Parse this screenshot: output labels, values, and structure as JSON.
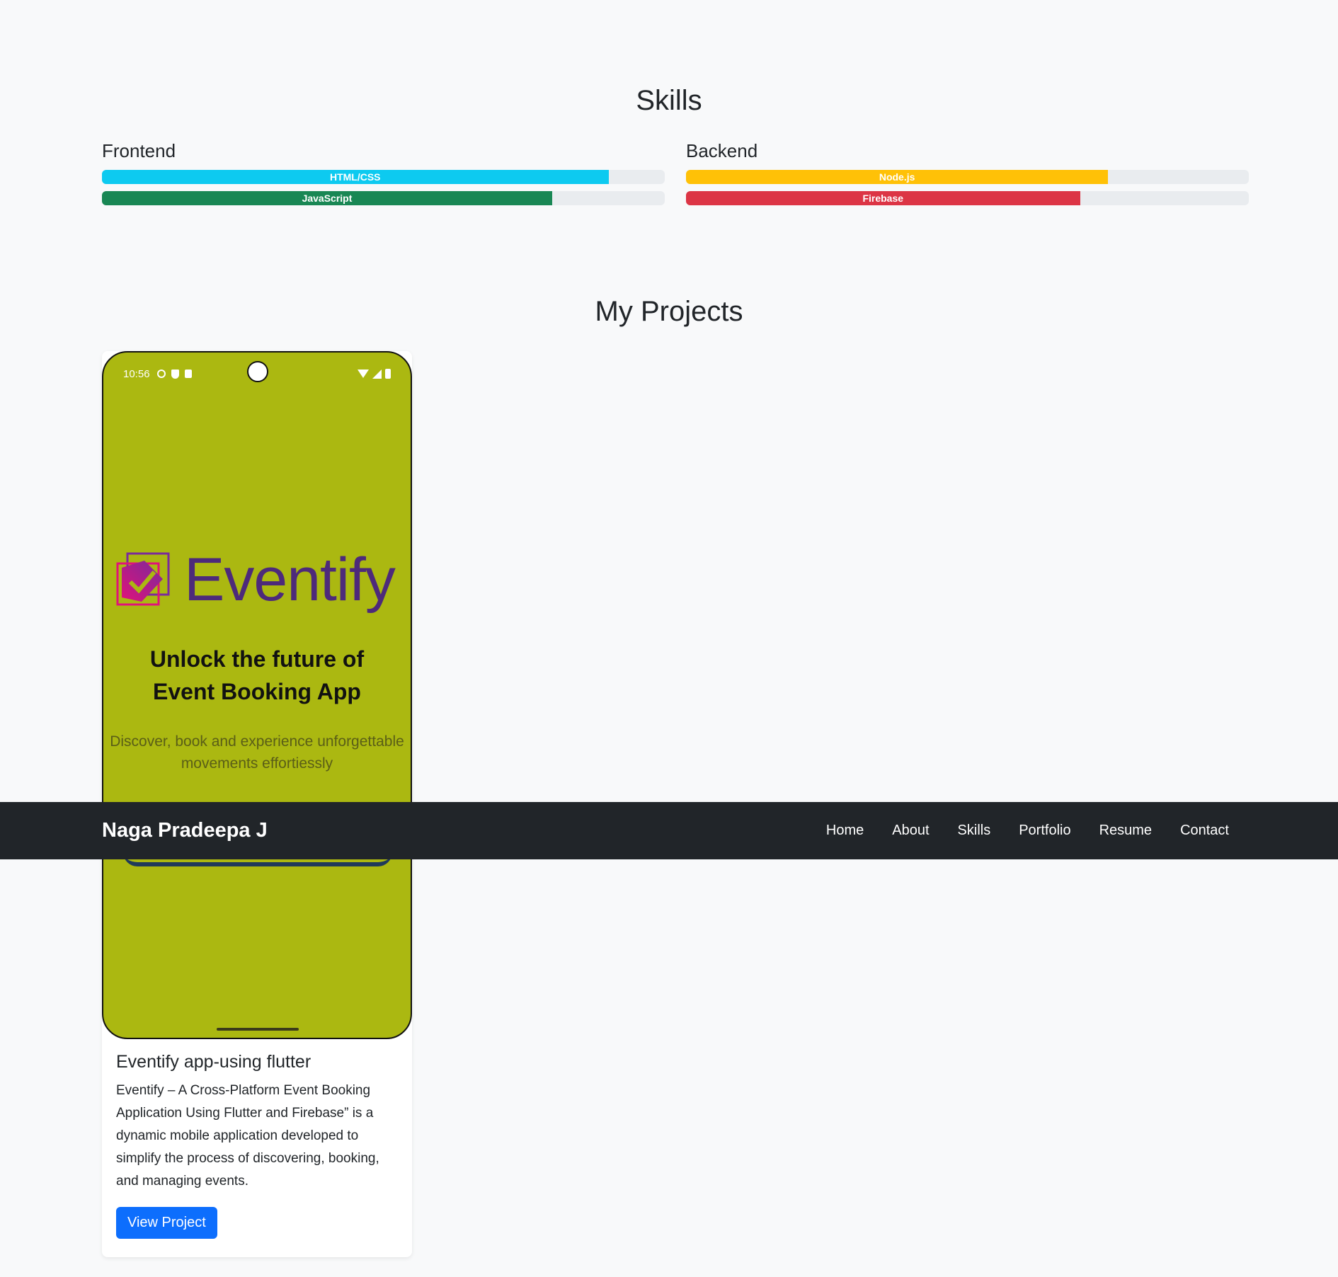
{
  "skills": {
    "title": "Skills",
    "frontend": {
      "heading": "Frontend",
      "items": [
        {
          "label": "HTML/CSS",
          "percent": 90,
          "color": "#0dcaf0"
        },
        {
          "label": "JavaScript",
          "percent": 80,
          "color": "#198754"
        }
      ]
    },
    "backend": {
      "heading": "Backend",
      "items": [
        {
          "label": "Node.js",
          "percent": 75,
          "color": "#ffc107"
        },
        {
          "label": "Firebase",
          "percent": 70,
          "color": "#dc3545"
        }
      ]
    }
  },
  "projects": {
    "title": "My Projects",
    "items": [
      {
        "screenshot": {
          "time": "10:56",
          "logo_text": "Eventify",
          "headline_line1": "Unlock the future of",
          "headline_line2": "Event Booking App",
          "subtitle_line1": "Discover, book and experience unforgettable",
          "subtitle_line2": "movements effortiessly",
          "background": "#abb811"
        },
        "title": "Eventify app-using flutter",
        "description": "Eventify – A Cross-Platform Event Booking Application Using Flutter and Firebase” is a dynamic mobile application developed to simplify the process of discovering, booking, and managing events.",
        "button_label": "View Project"
      }
    ]
  },
  "navbar": {
    "brand": "Naga Pradeepa J",
    "links": [
      "Home",
      "About",
      "Skills",
      "Portfolio",
      "Resume",
      "Contact"
    ]
  }
}
